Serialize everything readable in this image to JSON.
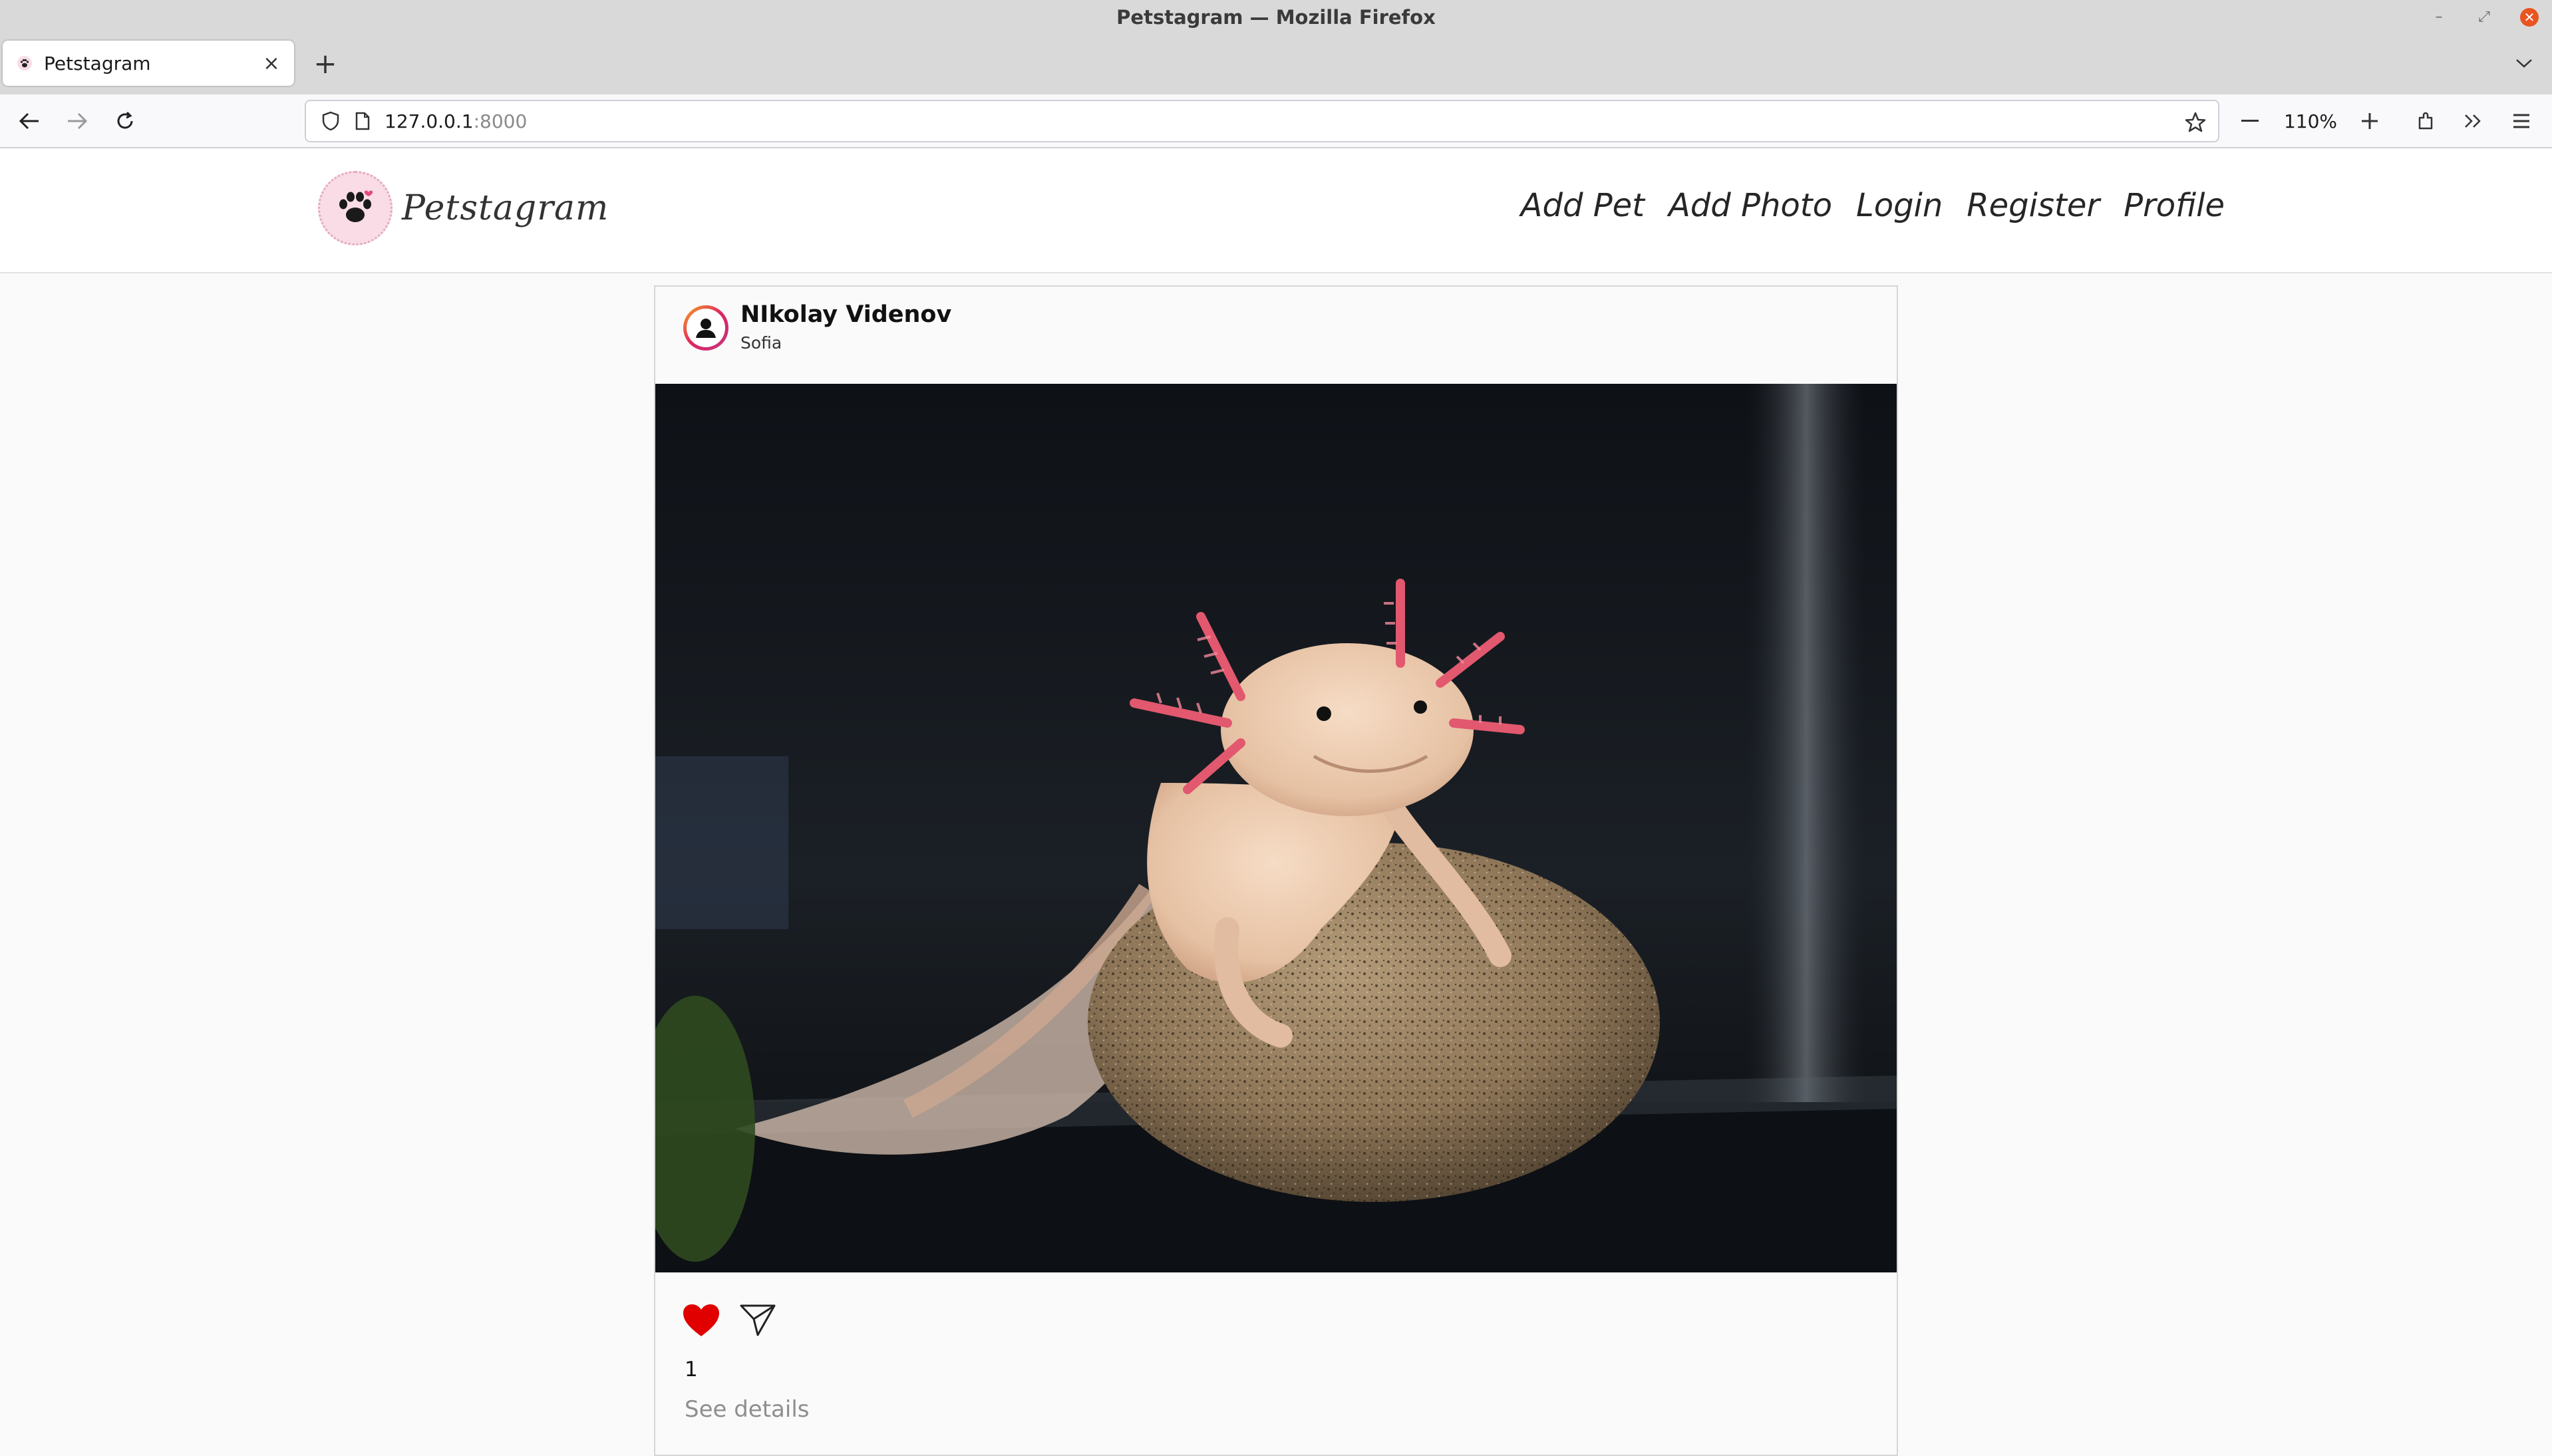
{
  "window": {
    "title": "Petstagram — Mozilla Firefox"
  },
  "tabs": [
    {
      "label": "Petstagram"
    }
  ],
  "toolbar": {
    "url_host": "127.0.0.1",
    "url_port": ":8000",
    "zoom": "110%"
  },
  "site": {
    "brand": "Petstagram",
    "nav": [
      "Add Pet",
      "Add Photo",
      "Login",
      "Register",
      "Profile"
    ]
  },
  "post": {
    "author": "NIkolay Videnov",
    "location": "Sofia",
    "likes": "1",
    "see_details": "See details",
    "liked": true
  },
  "colors": {
    "heart": "#e00000",
    "close_button": "#e95420",
    "logo_bg": "#f9dce6"
  }
}
